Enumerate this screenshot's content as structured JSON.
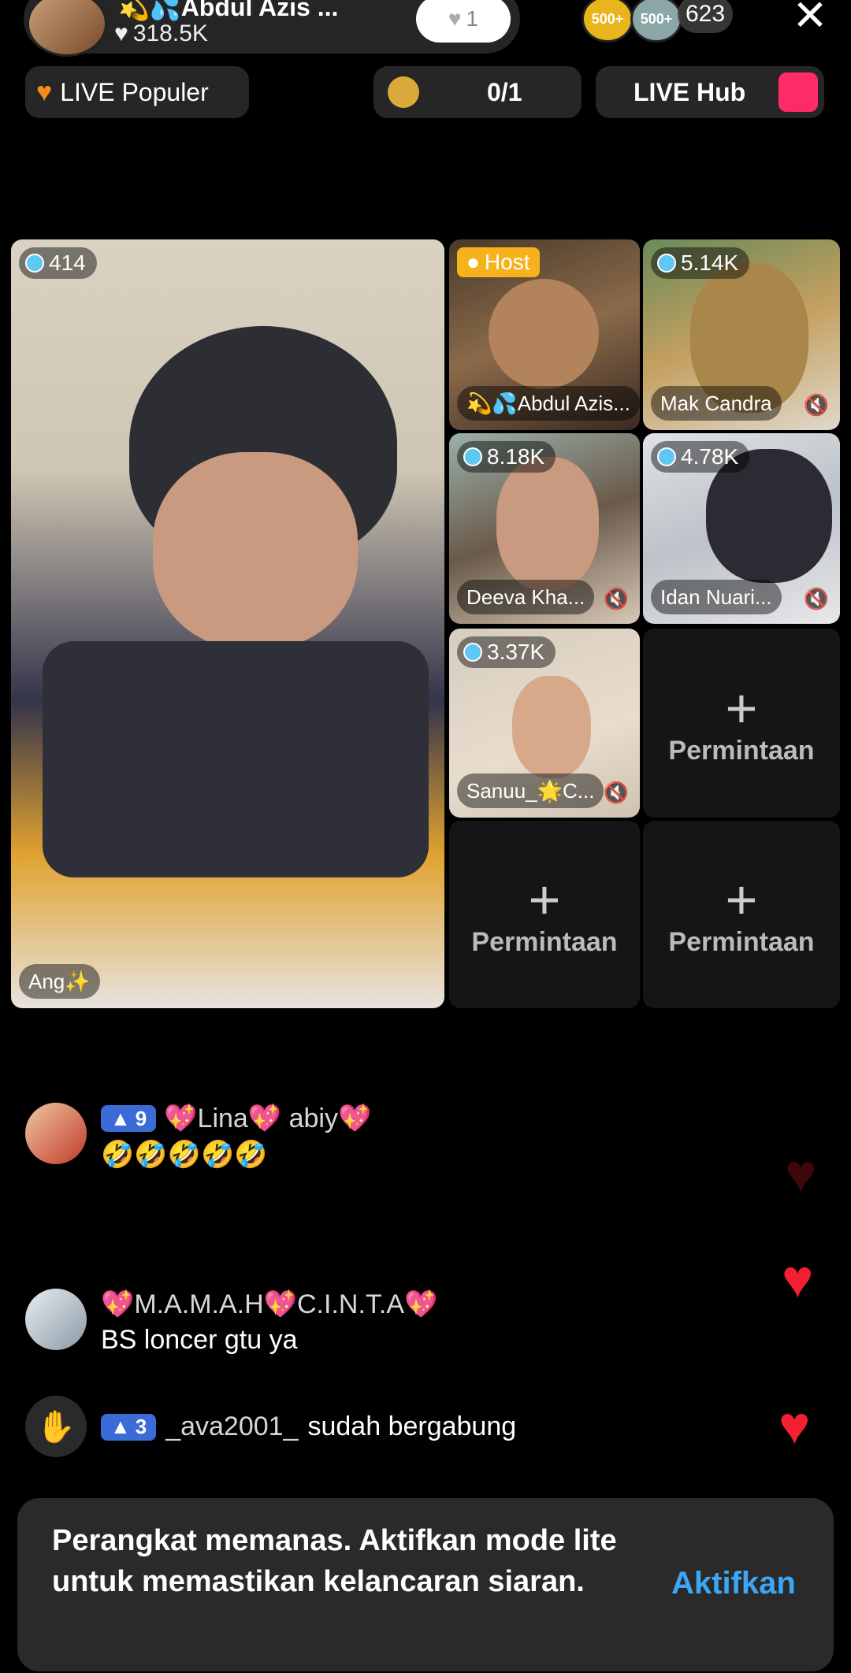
{
  "header": {
    "host_name": "💫💦Abdul Azis ...",
    "likes": "318.5K",
    "follow_count": "1",
    "badge1": "500+",
    "badge2": "500+",
    "viewer_count": "623"
  },
  "chips": {
    "popular": "LIVE Populer",
    "goal": "0/1",
    "hub": "LIVE Hub",
    "hub_icon_text": "LIVE Hub"
  },
  "grid": {
    "main": {
      "score": "414",
      "name": "Ang✨"
    },
    "host": {
      "badge": "Host",
      "name": "💫💦Abdul Azis..."
    },
    "t2": {
      "score": "5.14K",
      "name": "Mak Candra"
    },
    "t3": {
      "score": "8.18K",
      "name": "Deeva Kha..."
    },
    "t4": {
      "score": "4.78K",
      "name": "Idan Nuari..."
    },
    "t5": {
      "score": "3.37K",
      "name": "Sanuu_🌟C..."
    },
    "request_label": "Permintaan"
  },
  "comments": [
    {
      "level": "9",
      "name": "💖Lina💖 abiy💖",
      "text": "🤣🤣🤣🤣🤣"
    },
    {
      "name": "💖M.A.M.A.H💖C.I.N.T.A💖",
      "text": "BS loncer gtu ya"
    },
    {
      "level": "3",
      "name": "_ava2001_",
      "text": "sudah bergabung"
    }
  ],
  "toast": {
    "message": "Perangkat memanas. Aktifkan mode lite untuk memastikan kelancaran siaran.",
    "action": "Aktifkan"
  },
  "colors": {
    "accent_blue": "#3ca7f5",
    "heart_red": "#f31f32",
    "level_blue": "#3b6bd6",
    "host_yellow": "#f6b21d"
  }
}
